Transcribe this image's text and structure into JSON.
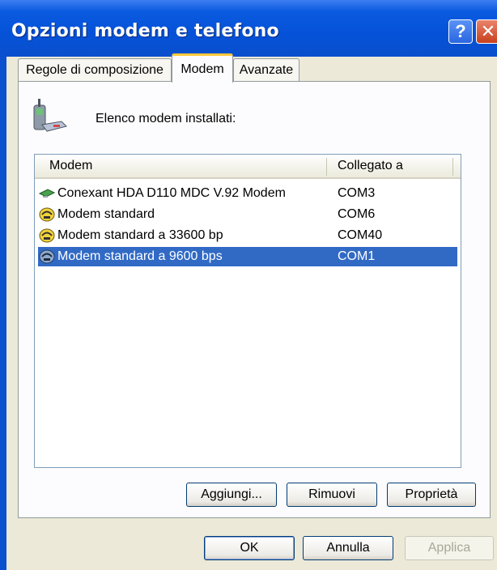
{
  "window": {
    "title": "Opzioni modem e telefono",
    "help_glyph": "?",
    "close_glyph": "✕"
  },
  "tabs": [
    {
      "label": "Regole di composizione",
      "active": false
    },
    {
      "label": "Modem",
      "active": true
    },
    {
      "label": "Avanzate",
      "active": false
    }
  ],
  "panel": {
    "installed_label": "Elenco modem installati:",
    "icon": "phone-modem-icon"
  },
  "listview": {
    "columns": {
      "modem": "Modem",
      "port": "Collegato a"
    },
    "rows": [
      {
        "name": "Conexant HDA D110 MDC V.92 Modem",
        "port": "COM3",
        "icon": "pci-modem-icon",
        "selected": false
      },
      {
        "name": "Modem standard",
        "port": "COM6",
        "icon": "modem-icon",
        "selected": false
      },
      {
        "name": "Modem standard a 33600 bp",
        "port": "COM40",
        "icon": "modem-icon",
        "selected": false
      },
      {
        "name": "Modem standard a 9600 bps",
        "port": "COM1",
        "icon": "modem-icon",
        "selected": true
      }
    ]
  },
  "buttons": {
    "add": "Aggiungi...",
    "remove": "Rimuovi",
    "properties": "Proprietà",
    "ok": "OK",
    "cancel": "Annulla",
    "apply": "Applica"
  },
  "colors": {
    "titlebar": "#0552d8",
    "selection": "#316ac5",
    "dialog_bg": "#ece9d8",
    "active_tab_accent": "#ffc83c"
  }
}
